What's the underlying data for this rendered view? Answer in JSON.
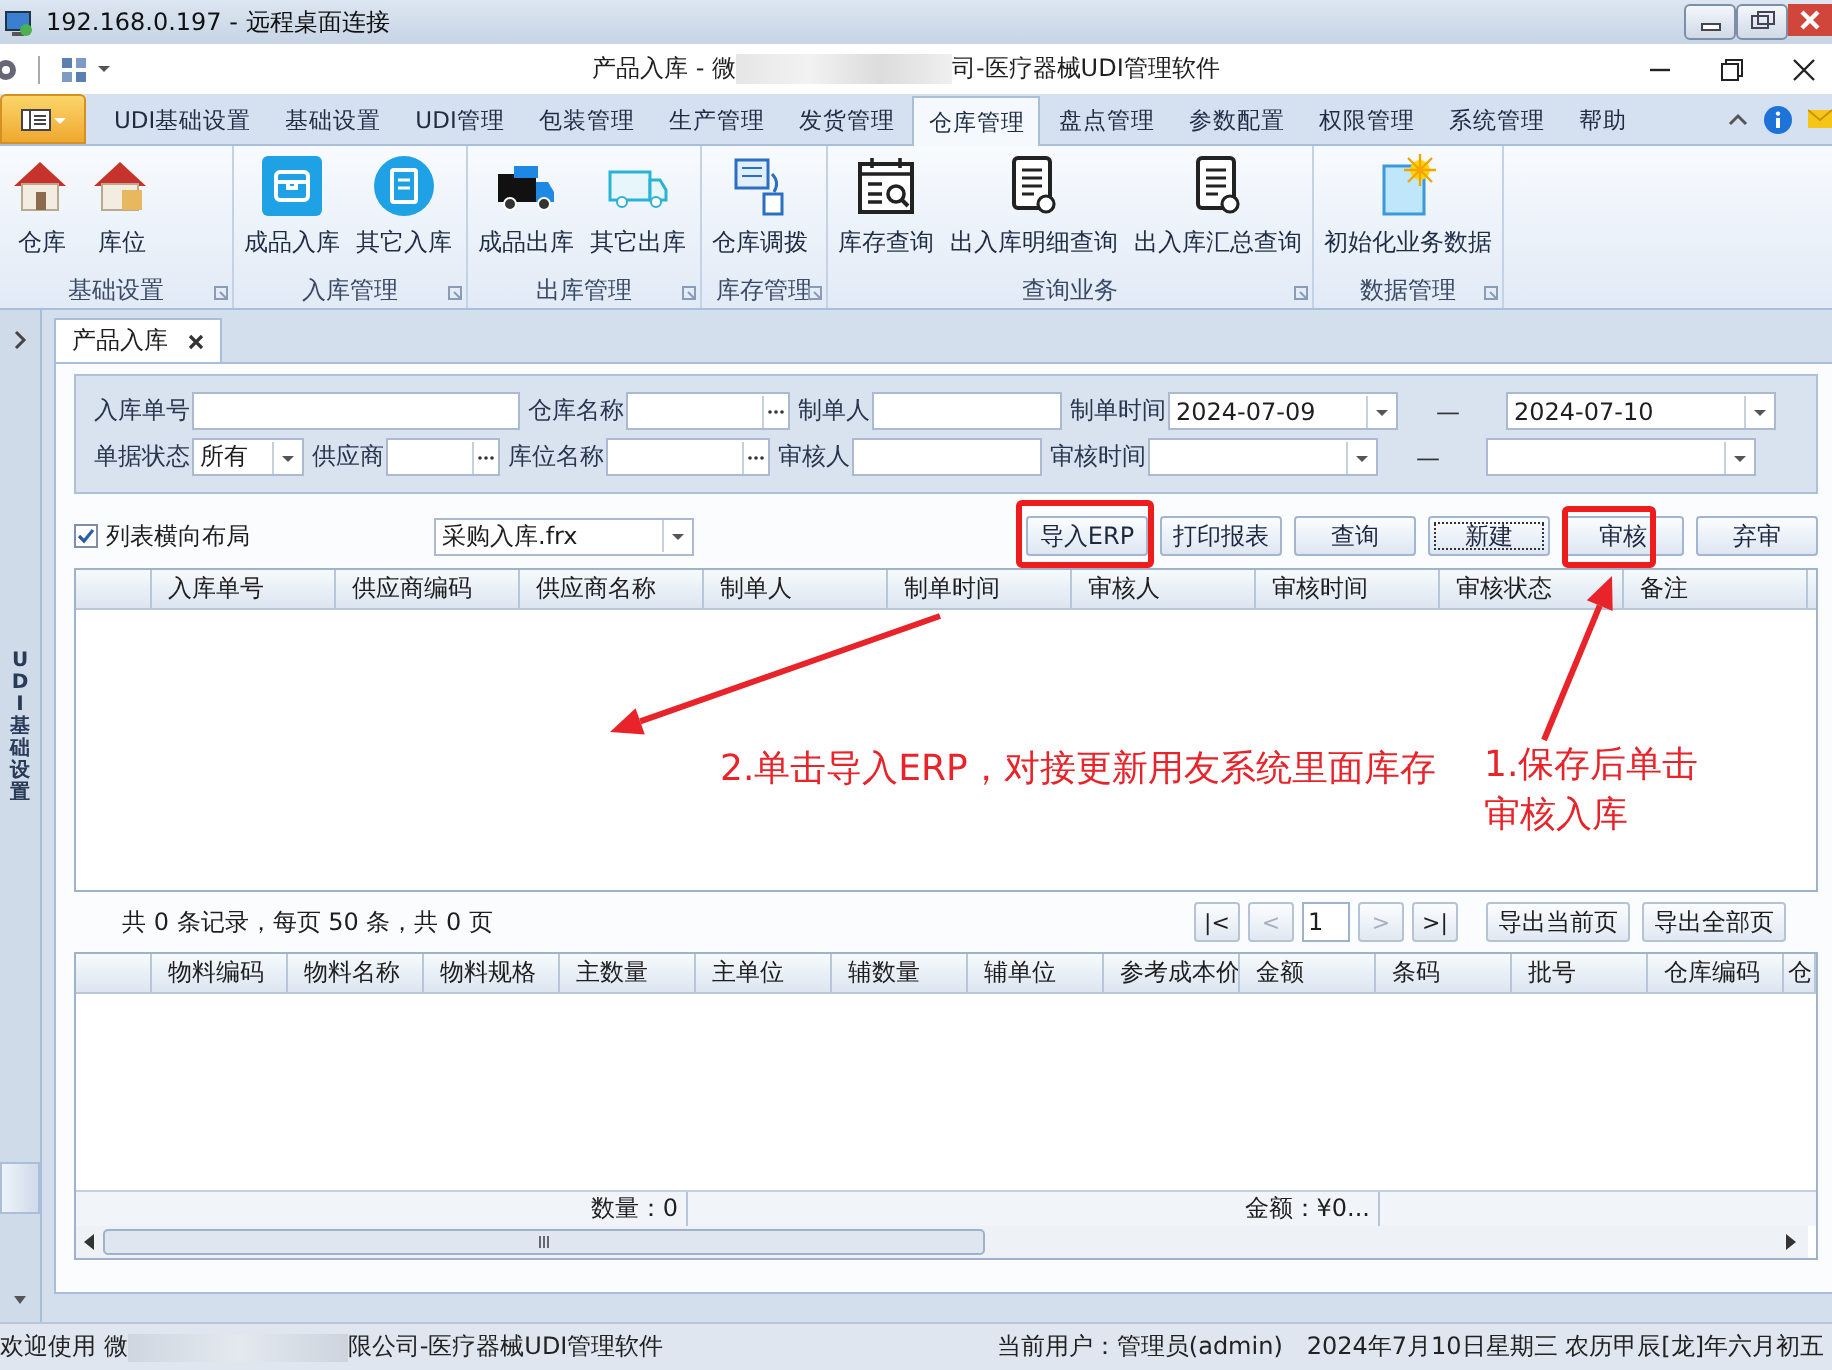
{
  "remote_window": {
    "title": "192.168.0.197 - 远程桌面连接"
  },
  "app_window": {
    "title_start": "产品入库 - 微",
    "title_end": "司-医疗器械UDI管理软件"
  },
  "menu_tabs": [
    {
      "label": "UDI基础设置",
      "selected": false
    },
    {
      "label": "基础设置",
      "selected": false
    },
    {
      "label": "UDI管理",
      "selected": false
    },
    {
      "label": "包装管理",
      "selected": false
    },
    {
      "label": "生产管理",
      "selected": false
    },
    {
      "label": "发货管理",
      "selected": false
    },
    {
      "label": "仓库管理",
      "selected": true
    },
    {
      "label": "盘点管理",
      "selected": false
    },
    {
      "label": "参数配置",
      "selected": false
    },
    {
      "label": "权限管理",
      "selected": false
    },
    {
      "label": "系统管理",
      "selected": false
    },
    {
      "label": "帮助",
      "selected": false
    }
  ],
  "ribbon": {
    "groups": [
      {
        "label": "基础设置",
        "buttons": [
          "仓库",
          "库位"
        ]
      },
      {
        "label": "入库管理",
        "buttons": [
          "成品入库",
          "其它入库"
        ]
      },
      {
        "label": "出库管理",
        "buttons": [
          "成品出库",
          "其它出库"
        ]
      },
      {
        "label": "库存管理",
        "buttons": [
          "仓库调拨"
        ]
      },
      {
        "label": "查询业务",
        "buttons": [
          "库存查询",
          "出入库明细查询",
          "出入库汇总查询"
        ]
      },
      {
        "label": "数据管理",
        "buttons": [
          "初始化业务数据"
        ]
      }
    ]
  },
  "side_rail": {
    "label": "UDI基础设置"
  },
  "document_tabs": [
    {
      "label": "产品入库",
      "selected": true
    }
  ],
  "filter": {
    "fields": [
      {
        "kind": "text",
        "label": "入库单号"
      },
      {
        "kind": "lookup",
        "label": "仓库名称"
      },
      {
        "kind": "text",
        "label": "制单人"
      },
      {
        "kind": "date",
        "label": "制单时间",
        "value": "2024-07-09"
      },
      {
        "kind": "separator",
        "text": "—"
      },
      {
        "kind": "date",
        "value": "2024-07-10"
      },
      {
        "kind": "combo",
        "label": "单据状态",
        "value": "所有"
      },
      {
        "kind": "lookup",
        "label": "供应商"
      },
      {
        "kind": "lookup",
        "label": "库位名称"
      },
      {
        "kind": "text",
        "label": "审核人"
      },
      {
        "kind": "date",
        "label": "审核时间"
      },
      {
        "kind": "separator",
        "text": "—"
      },
      {
        "kind": "date"
      }
    ]
  },
  "toolbar": {
    "layout_checkbox": {
      "label": "列表横向布局",
      "checked": true
    },
    "report_template": {
      "value": "采购入库.frx"
    },
    "buttons": [
      {
        "label": "导入ERP",
        "focused": false,
        "highlighted": true
      },
      {
        "label": "打印报表",
        "focused": false,
        "highlighted": false
      },
      {
        "label": "查询",
        "focused": false,
        "highlighted": false
      },
      {
        "label": "新建",
        "focused": true,
        "highlighted": false
      },
      {
        "label": "审核",
        "focused": false,
        "highlighted": true
      },
      {
        "label": "弃审",
        "focused": false,
        "highlighted": false
      }
    ]
  },
  "receipt_table": {
    "columns": [
      "入库单号",
      "供应商编码",
      "供应商名称",
      "制单人",
      "制单时间",
      "审核人",
      "审核时间",
      "审核状态",
      "备注"
    ]
  },
  "pager": {
    "summary": "共 0 条记录，每页 50 条，共 0 页",
    "nav": [
      {
        "label": "|<",
        "disabled": false
      },
      {
        "label": "<",
        "disabled": true
      },
      {
        "label": ">",
        "disabled": true
      },
      {
        "label": ">|",
        "disabled": false
      }
    ],
    "page": "1",
    "exports": [
      "导出当前页",
      "导出全部页"
    ]
  },
  "detail_table": {
    "columns": [
      "物料编码",
      "物料名称",
      "物料规格",
      "主数量",
      "主单位",
      "辅数量",
      "辅单位",
      "参考成本价",
      "金额",
      "条码",
      "批号",
      "仓库编码",
      "仓"
    ],
    "totals": [
      "数量：0",
      "金额：¥0..."
    ]
  },
  "status_bar": {
    "welcome_start": "欢迎使用 微",
    "welcome_end": "限公司-医疗器械UDI管理软件",
    "user": "当前用户：管理员(admin)",
    "date": "2024年7月10日星期三 农历甲辰[龙]年六月初五"
  },
  "annotations": [
    {
      "lines": [
        "2.单击导入ERP，对接更新用友系统里面库存"
      ]
    },
    {
      "lines": [
        "1.保存后单击",
        "审核入库"
      ]
    }
  ]
}
